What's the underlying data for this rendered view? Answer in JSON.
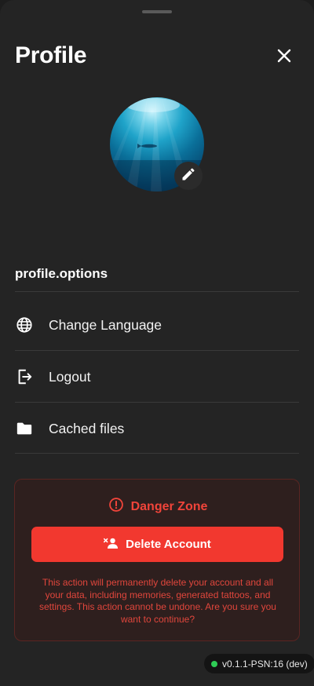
{
  "header": {
    "title": "Profile",
    "close_icon": "close-icon"
  },
  "avatar": {
    "image": "underwater ocean scene with sunlight",
    "edit_icon": "pencil-icon"
  },
  "options": {
    "heading": "profile.options",
    "items": [
      {
        "icon": "globe-icon",
        "label": "Change Language"
      },
      {
        "icon": "logout-icon",
        "label": "Logout"
      },
      {
        "icon": "folder-icon",
        "label": "Cached files"
      }
    ]
  },
  "danger_zone": {
    "title": "Danger Zone",
    "title_icon": "alert-circle-icon",
    "delete_button_label": "Delete Account",
    "delete_button_icon": "remove-user-icon",
    "warning_text": "This action will permanently delete your account and all your data, including memories, generated tattoos, and settings. This action cannot be undone. Are you sure you want to continue?",
    "accent_color": "#f2382f"
  },
  "footer": {
    "version": "v0.1.1-PSN:16 (dev)",
    "status_color": "#2ecc55"
  }
}
